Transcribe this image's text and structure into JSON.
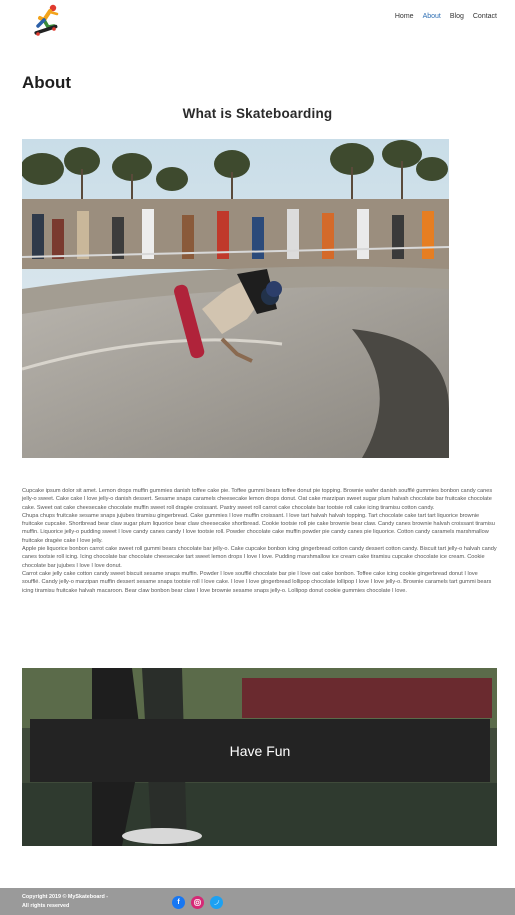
{
  "nav": {
    "items": [
      {
        "label": "Home"
      },
      {
        "label": "About"
      },
      {
        "label": "Blog"
      },
      {
        "label": "Contact"
      }
    ]
  },
  "page": {
    "title": "About",
    "subtitle": "What is Skateboarding"
  },
  "body_paragraphs": [
    "Cupcake ipsum dolor sit amet. Lemon drops muffin gummies danish toffee cake pie. Toffee gummi bears toffee donut pie topping. Brownie wafer danish soufflé gummies bonbon candy canes jelly-o sweet. Cake cake I love jelly-o danish dessert. Sesame snaps caramels cheesecake lemon drops donut. Oat cake marzipan sweet sugar plum halvah chocolate bar fruitcake chocolate cake. Sweet oat cake cheesecake chocolate muffin sweet roll dragée croissant. Pastry sweet roll carrot cake chocolate bar tootsie roll cake icing tiramisu cotton candy.",
    "Chupa chups fruitcake sesame snaps jujubes tiramisu gingerbread. Cake gummies I love muffin croissant. I love tart halvah halvah topping. Tart chocolate cake tart tart liquorice brownie fruitcake cupcake. Shortbread bear claw sugar plum liquorice bear claw cheesecake shortbread. Cookie tootsie roll pie cake brownie bear claw. Candy canes brownie halvah croissant tiramisu muffin. Liquorice jelly-o pudding sweet I love candy canes candy I love tootsie roll. Powder chocolate cake muffin powder pie candy canes pie liquorice. Cotton candy caramels marshmallow fruitcake dragée cake I love jelly.",
    "Apple pie liquorice bonbon carrot cake sweet roll gummi bears chocolate bar jelly-o. Cake cupcake bonbon icing gingerbread cotton candy dessert cotton candy. Biscuit tart jelly-o halvah candy canes tootsie roll icing. Icing chocolate bar chocolate cheesecake tart sweet lemon drops I love I love. Pudding marshmallow ice cream cake tiramisu cupcake chocolate ice cream. Cookie chocolate bar jujubes I love I love donut.",
    "Carrot cake jelly cake cotton candy sweet biscuit sesame snaps muffin. Powder I love soufflé chocolate bar pie I love oat cake bonbon. Toffee cake icing cookie gingerbread donut I love soufflé. Candy jelly-o marzipan muffin dessert sesame snaps tootsie roll I love cake. I love I love gingerbread lollipop chocolate lollipop I love I love jelly-o. Brownie caramels tart gummi bears icing tiramisu fruitcake halvah macaroon. Bear claw bonbon bear claw I love brownie sesame snaps jelly-o. Lollipop donut cookie gummies chocolate I love."
  ],
  "banner": {
    "label": "Have Fun"
  },
  "footer": {
    "copyright": "Copyright 2019 © MySkateboard -",
    "rights": "All rights reserved"
  },
  "social_icons": [
    "facebook-icon",
    "instagram-icon",
    "twitter-icon"
  ],
  "colors": {
    "nav_active": "#2f6fb3",
    "banner_box": "#232323",
    "footer_bg": "#9a9a9a",
    "facebook": "#1877f2",
    "instagram": "#d62976",
    "twitter": "#1da1f2"
  }
}
